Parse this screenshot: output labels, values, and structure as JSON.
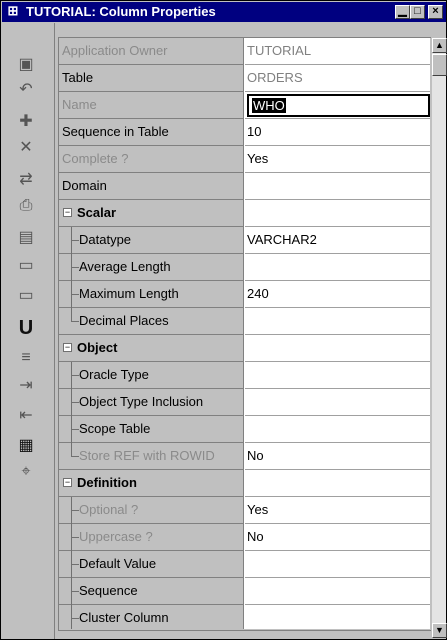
{
  "window": {
    "title": "TUTORIAL: Column Properties",
    "title_icon": "grid-icon",
    "minimize_glyph": "▁",
    "maximize_glyph": "□",
    "close_glyph": "×"
  },
  "toolbar": {
    "tools": [
      {
        "name": "save-icon",
        "glyph": "▣"
      },
      {
        "name": "revert-icon",
        "glyph": "↶"
      },
      {
        "name": "add-child-icon",
        "glyph": "✚"
      },
      {
        "name": "delete-icon",
        "glyph": "✕"
      },
      {
        "name": "transfer-icon",
        "glyph": "⇄"
      },
      {
        "name": "print-icon",
        "glyph": "⎙"
      },
      {
        "name": "report-icon",
        "glyph": "▤"
      },
      {
        "name": "ascii-export-icon",
        "glyph": "▭"
      },
      {
        "name": "html-export-icon",
        "glyph": "▭"
      },
      {
        "name": "underline-icon",
        "glyph": "U"
      },
      {
        "name": "copy-properties-icon",
        "glyph": "≡"
      },
      {
        "name": "import-icon",
        "glyph": "⇥"
      },
      {
        "name": "export-icon",
        "glyph": "⇤"
      },
      {
        "name": "table-icon",
        "glyph": "▦"
      },
      {
        "name": "pin-icon",
        "glyph": "⌖"
      }
    ]
  },
  "properties": [
    {
      "label": "Application Owner",
      "value": "TUTORIAL",
      "kind": "prop",
      "dim": true,
      "ro": true
    },
    {
      "label": "Table",
      "value": "ORDERS",
      "kind": "prop",
      "dim": false,
      "ro": true
    },
    {
      "label": "Name",
      "value": "WHO",
      "kind": "prop",
      "dim": true,
      "editing": true
    },
    {
      "label": "Sequence in Table",
      "value": "10",
      "kind": "prop"
    },
    {
      "label": "Complete ?",
      "value": "Yes",
      "kind": "prop",
      "dim": true
    },
    {
      "label": "Domain",
      "value": "",
      "kind": "prop"
    },
    {
      "label": "Scalar",
      "value": "",
      "kind": "group"
    },
    {
      "label": "Datatype",
      "value": "VARCHAR2",
      "kind": "child"
    },
    {
      "label": "Average Length",
      "value": "",
      "kind": "child"
    },
    {
      "label": "Maximum Length",
      "value": "240",
      "kind": "child"
    },
    {
      "label": "Decimal Places",
      "value": "",
      "kind": "child",
      "last": true
    },
    {
      "label": "Object",
      "value": "",
      "kind": "group"
    },
    {
      "label": "Oracle Type",
      "value": "",
      "kind": "child"
    },
    {
      "label": "Object Type Inclusion",
      "value": "",
      "kind": "child"
    },
    {
      "label": "Scope Table",
      "value": "",
      "kind": "child"
    },
    {
      "label": "Store REF with ROWID",
      "value": "No",
      "kind": "child",
      "dim": true,
      "last": true
    },
    {
      "label": "Definition",
      "value": "",
      "kind": "group"
    },
    {
      "label": "Optional ?",
      "value": "Yes",
      "kind": "child",
      "dim": true
    },
    {
      "label": "Uppercase ?",
      "value": "No",
      "kind": "child",
      "dim": true
    },
    {
      "label": "Default Value",
      "value": "",
      "kind": "child"
    },
    {
      "label": "Sequence",
      "value": "",
      "kind": "child"
    },
    {
      "label": "Cluster Column",
      "value": "",
      "kind": "child"
    }
  ],
  "expander_glyph": "−",
  "scrollbar": {
    "up_glyph": "▲",
    "down_glyph": "▼",
    "position": 0.0
  }
}
